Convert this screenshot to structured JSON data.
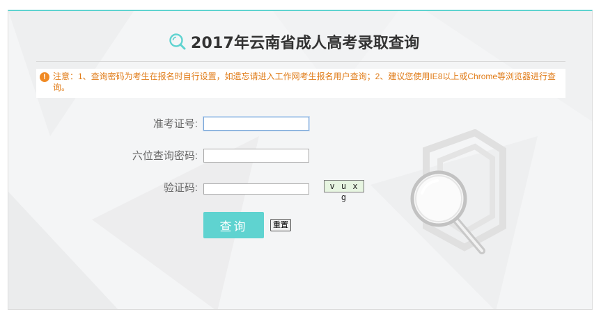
{
  "header": {
    "title": "2017年云南省成人高考录取查询",
    "icon": "search-icon"
  },
  "notice": {
    "icon": "exclamation-icon",
    "text": "注意：1、查询密码为考生在报名时自行设置，如遗忘请进入工作网考生报名用户查询；2、建议您使用IE8以上或Chrome等浏览器进行查询。"
  },
  "form": {
    "exam_number_label": "准考证号:",
    "exam_number_value": "",
    "password_label": "六位查询密码:",
    "password_value": "",
    "captcha_label": "验证码:",
    "captcha_value": "",
    "captcha_image_text": "v u x g",
    "query_button": "查询",
    "reset_button": "重置"
  },
  "colors": {
    "accent": "#5fd3d0",
    "notice": "#e07b17",
    "notice_icon": "#f08a24"
  }
}
